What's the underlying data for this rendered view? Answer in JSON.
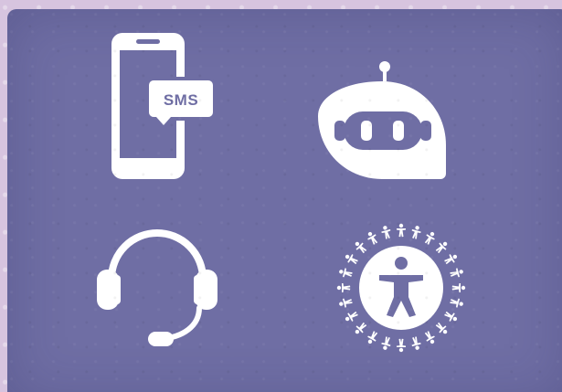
{
  "icons": [
    {
      "name": "sms-phone-icon",
      "label": "SMS"
    },
    {
      "name": "chatbot-icon"
    },
    {
      "name": "headset-icon"
    },
    {
      "name": "accessibility-icon"
    }
  ],
  "colors": {
    "panel": "#6f6ea4",
    "icon": "#ffffff",
    "background": "#d7c4df"
  }
}
